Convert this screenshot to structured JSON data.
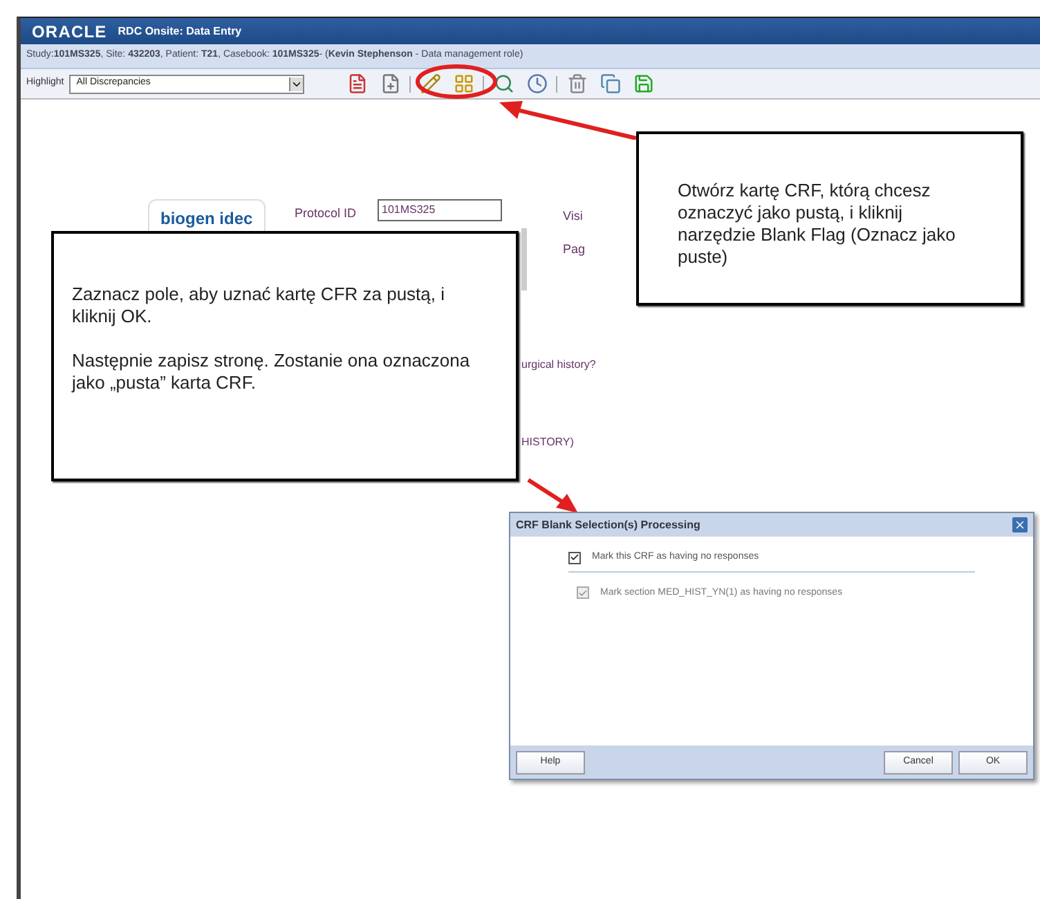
{
  "window": {
    "logo": "ORACLE",
    "title": "RDC Onsite: Data Entry"
  },
  "info_bar": "Study:**101MS325**, Site: **432203**, Patient: **T21**, Casebook: **101MS325**- (**Kevin Stephenson** - Data management role)",
  "toolbar": {
    "highlight_label": "Highlight",
    "highlight_value": "All Discrepancies"
  },
  "form": {
    "logo_text": "biogen idec",
    "protocol_label": "Protocol ID",
    "protocol_value": "101MS325",
    "visit_label": "Visi",
    "page_label": "Pag",
    "question": "urgical history?",
    "section": "HISTORY)"
  },
  "callouts": [
    {
      "text": "Otwórz kartę CRF, którą chcesz oznaczyć jako pustą, i kliknij narzędzie Blank Flag (Oznacz jako puste)"
    },
    {
      "paragraphs": [
        "Zaznacz pole, aby uznać kartę CFR za pustą, i kliknij OK.",
        "Następnie zapisz stronę. Zostanie ona oznaczona jako „pusta” karta CRF."
      ]
    }
  ],
  "dialog": {
    "title": "CRF Blank Selection(s) Processing",
    "options": [
      {
        "label": "Mark this CRF as having no responses",
        "checked": true,
        "disabled": false
      },
      {
        "label": "Mark section MED_HIST_YN(1) as having no responses",
        "checked": true,
        "disabled": true
      }
    ],
    "buttons": [
      "Help",
      "Cancel",
      "OK"
    ]
  }
}
